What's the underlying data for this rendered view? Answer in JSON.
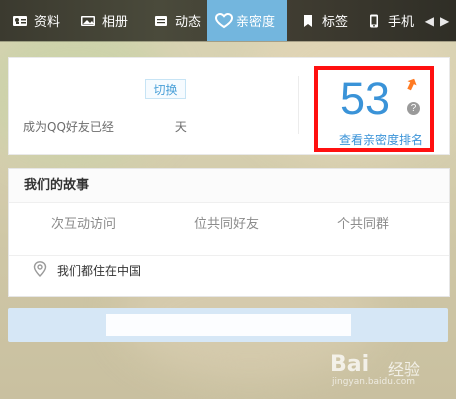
{
  "nav": {
    "tabs": [
      {
        "label": "资料",
        "icon": "profile-card-icon"
      },
      {
        "label": "相册",
        "icon": "photo-icon"
      },
      {
        "label": "动态",
        "icon": "feed-icon"
      },
      {
        "label": "亲密度",
        "icon": "heart-icon",
        "active": true
      },
      {
        "label": "标签",
        "icon": "bookmark-icon"
      },
      {
        "label": "手机",
        "icon": "phone-icon"
      }
    ],
    "arrows": {
      "left": "◀",
      "right": "▶"
    }
  },
  "intimacy": {
    "switch_label": "切换",
    "friend_days_prefix": "成为QQ好友已经",
    "friend_days_suffix": "天",
    "score": "53",
    "help": "?",
    "rank_link": "查看亲密度排名",
    "trend": "up"
  },
  "story": {
    "title": "我们的故事",
    "stats": [
      "次互动访问",
      "位共同好友",
      "个共同群"
    ],
    "location": "我们都住在中国"
  },
  "watermark": {
    "logo": "Bai",
    "sub": "经验",
    "url": "jingyan.baidu.com"
  },
  "colors": {
    "accent": "#3a93d8",
    "active_tab": "#73b6de",
    "highlight_box": "#ff1010",
    "trend_up": "#ff7a22"
  }
}
